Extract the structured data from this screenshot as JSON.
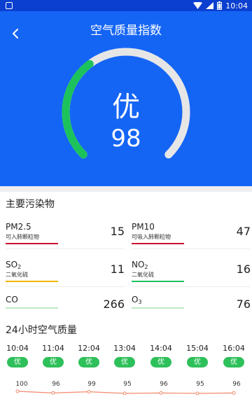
{
  "statusbar": {
    "time": "10:04"
  },
  "header": {
    "title": "空气质量指数",
    "grade": "优",
    "score": "98",
    "score_fraction": 0.98
  },
  "colors": {
    "header_bg": "#1565f5",
    "gauge_fill": "#1cc25b",
    "gauge_track": "#e6e6e6",
    "good_badge": "#2ec05a",
    "trend_line": "#f28a6b"
  },
  "pollutants": {
    "section_title": "主要污染物",
    "items": [
      {
        "name": "PM2.5",
        "sub": "",
        "desc": "可入肺颗粒物",
        "value": "15",
        "bar_color": "#c8102e"
      },
      {
        "name": "PM10",
        "sub": "",
        "desc": "可吸入肺颗粒物",
        "value": "47",
        "bar_color": "#c8102e"
      },
      {
        "name": "SO",
        "sub": "2",
        "desc": "二氧化硫",
        "value": "11",
        "bar_color": "#f5b400"
      },
      {
        "name": "NO",
        "sub": "2",
        "desc": "二氧化硫",
        "value": "16",
        "bar_color": "#1cc25b"
      },
      {
        "name": "CO",
        "sub": "",
        "desc": "",
        "value": "266",
        "bar_color": "#bfe6c6"
      },
      {
        "name": "O",
        "sub": "3",
        "desc": "",
        "value": "76",
        "bar_color": "#bfe6c6"
      }
    ]
  },
  "hourly": {
    "section_title": "24小时空气质量",
    "hours": [
      {
        "time": "10:04",
        "grade": "优",
        "aqi": "100",
        "aqi_value": 100
      },
      {
        "time": "11:04",
        "grade": "优",
        "aqi": "96",
        "aqi_value": 96
      },
      {
        "time": "12:04",
        "grade": "优",
        "aqi": "99",
        "aqi_value": 99
      },
      {
        "time": "13:04",
        "grade": "优",
        "aqi": "95",
        "aqi_value": 95
      },
      {
        "time": "14:04",
        "grade": "优",
        "aqi": "96",
        "aqi_value": 96
      },
      {
        "time": "15:04",
        "grade": "优",
        "aqi": "95",
        "aqi_value": 95
      },
      {
        "time": "16:04",
        "grade": "优",
        "aqi": "96",
        "aqi_value": 96
      }
    ]
  }
}
